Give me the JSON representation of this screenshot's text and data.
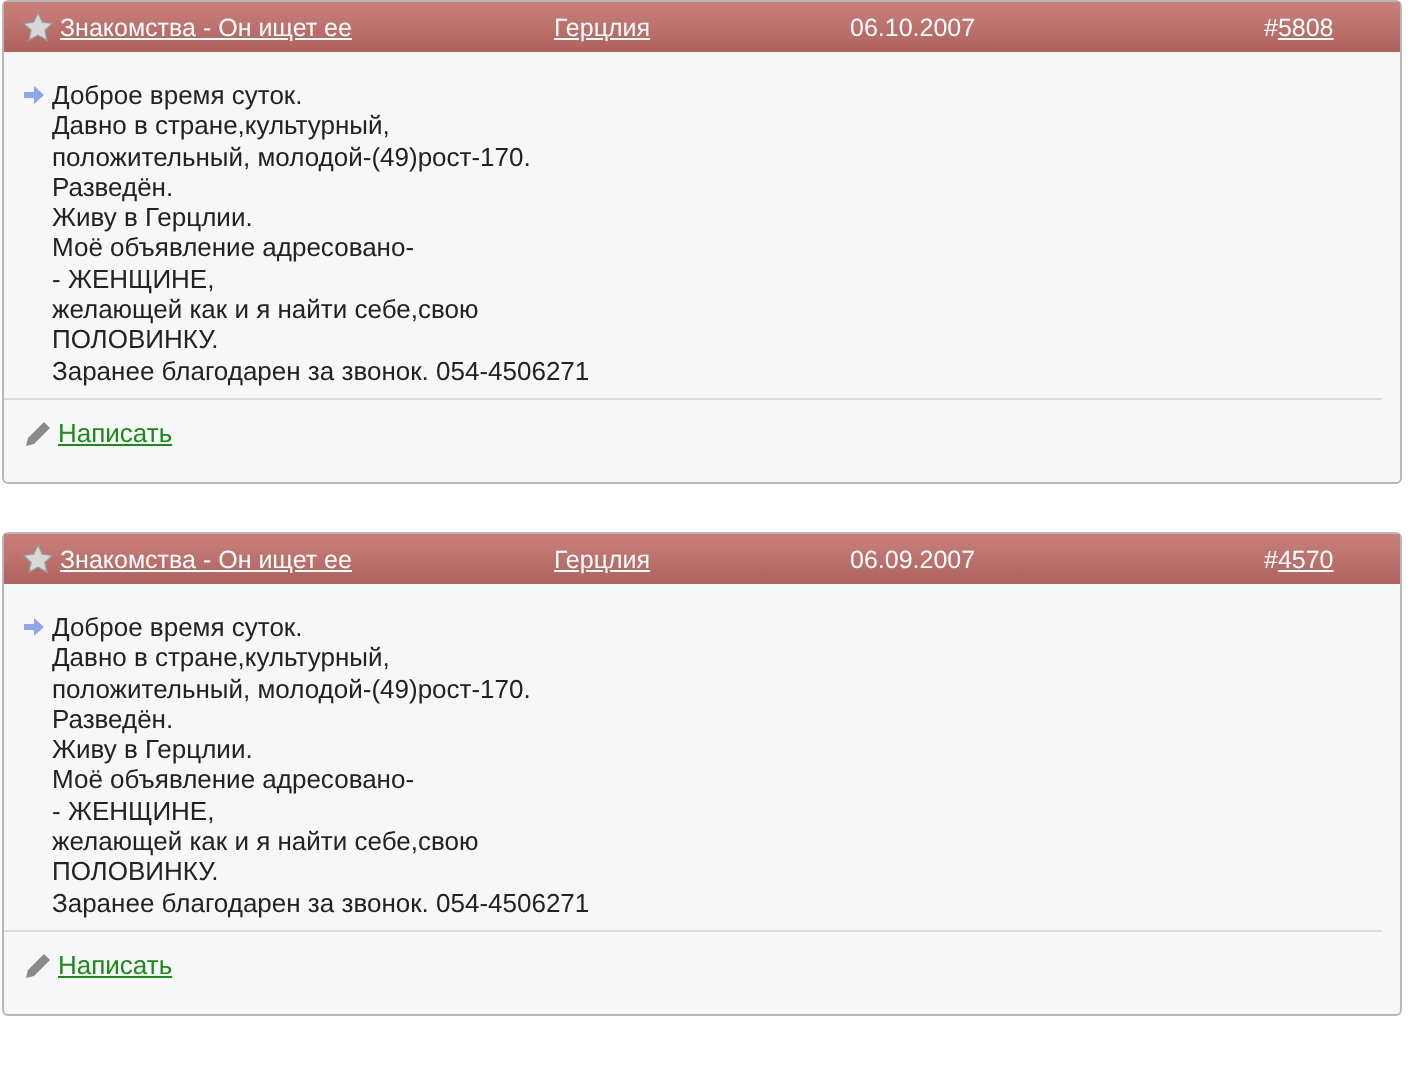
{
  "posts": [
    {
      "category": "Знакомства - Он ищет ее",
      "city": "Герцлия",
      "date": "06.10.2007",
      "number_prefix": "#",
      "number": "5808",
      "message_lines": [
        "Доброе время суток.",
        "Давно в стране,культурный,",
        "положительный, молодой-(49)рост-170.",
        "Разведён.",
        "Живу в Герцлии.",
        "Моё объявление адресовано-",
        "- ЖЕНЩИНЕ,",
        "желающей как и я найти себе,свою",
        "ПОЛОВИНКУ.",
        "Заранее благодарен за звонок. 054-4506271"
      ],
      "reply_link": "Написать"
    },
    {
      "category": "Знакомства - Он ищет ее",
      "city": "Герцлия",
      "date": "06.09.2007",
      "number_prefix": "#",
      "number": "4570",
      "message_lines": [
        "Доброе время суток.",
        "Давно в стране,культурный,",
        "положительный, молодой-(49)рост-170.",
        "Разведён.",
        "Живу в Герцлии.",
        "Моё объявление адресовано-",
        "- ЖЕНЩИНЕ,",
        "желающей как и я найти себе,свою",
        "ПОЛОВИНКУ.",
        "Заранее благодарен за звонок. 054-4506271"
      ],
      "reply_link": "Написать"
    }
  ]
}
